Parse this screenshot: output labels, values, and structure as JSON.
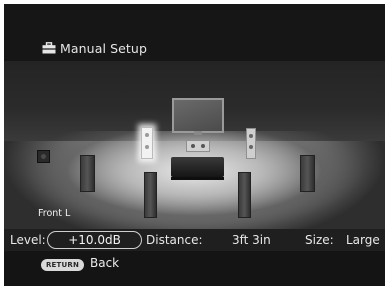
{
  "header": {
    "icon": "toolbox-icon",
    "title": "Manual Setup"
  },
  "scene": {
    "selected_speaker": "Front L"
  },
  "status": {
    "level_label": "Level:",
    "level_value": "+10.0dB",
    "distance_label": "Distance:",
    "distance_value": "3ft  3in",
    "size_label": "Size:",
    "size_value": "Large"
  },
  "footer": {
    "return_key": "RETURN",
    "back_label": "Back"
  }
}
